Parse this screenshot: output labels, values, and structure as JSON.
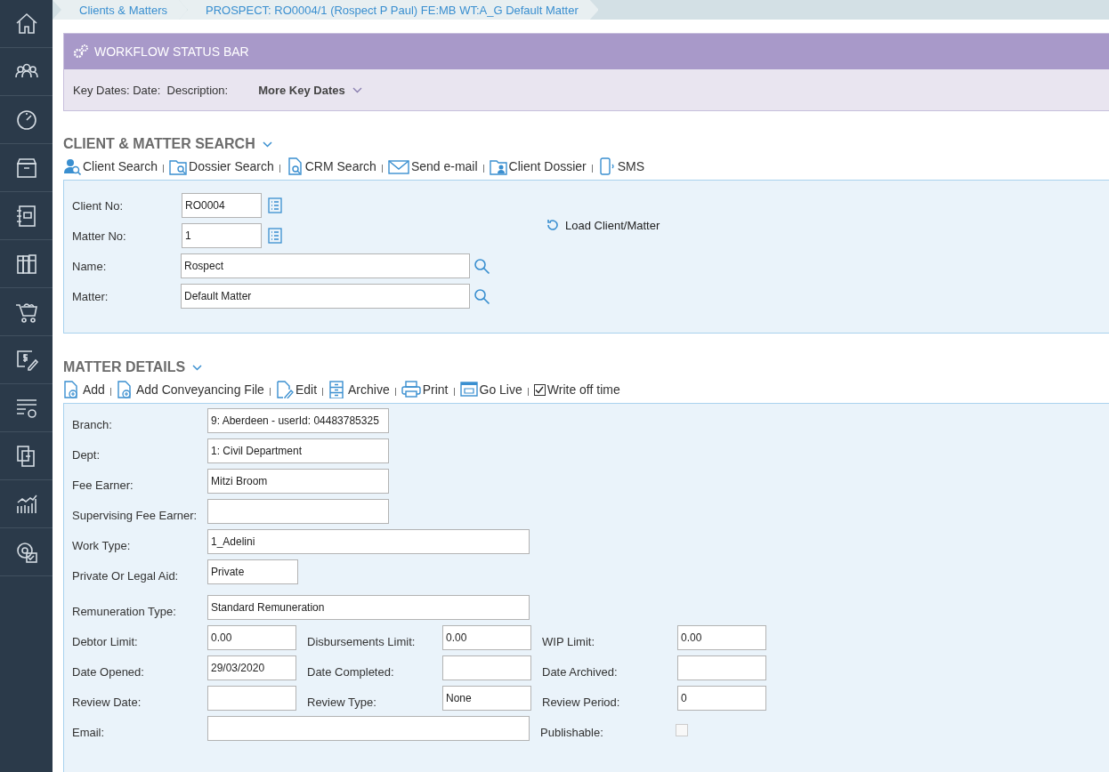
{
  "breadcrumbs": [
    {
      "label": "Clients & Matters"
    },
    {
      "label": "PROSPECT: RO0004/1 (Rospect P Paul) FE:MB WT:A_G Default Matter"
    }
  ],
  "workflow": {
    "title": "WORKFLOW STATUS BAR",
    "key_dates_label": "Key Dates: Date:",
    "description_label": "Description:",
    "more_button": "More Key Dates"
  },
  "client_search": {
    "title": "CLIENT & MATTER SEARCH",
    "toolbar": [
      {
        "label": "Client Search"
      },
      {
        "label": "Dossier Search"
      },
      {
        "label": "CRM Search"
      },
      {
        "label": "Send e-mail"
      },
      {
        "label": "Client Dossier"
      },
      {
        "label": "SMS"
      }
    ],
    "fields": [
      {
        "label": "Client No:",
        "value": "RO0004"
      },
      {
        "label": "Matter No:",
        "value": "1"
      },
      {
        "label": "Name:",
        "value": "Rospect"
      },
      {
        "label": "Matter:",
        "value": "Default Matter"
      }
    ],
    "load_button": "Load Client/Matter"
  },
  "matter_details": {
    "title": "MATTER DETAILS",
    "toolbar": [
      {
        "kind": "link",
        "label": "Add"
      },
      {
        "kind": "link",
        "label": "Add Conveyancing File"
      },
      {
        "kind": "link",
        "label": "Edit"
      },
      {
        "kind": "link",
        "label": "Archive"
      },
      {
        "kind": "link",
        "label": "Print"
      },
      {
        "kind": "link",
        "label": "Go Live"
      },
      {
        "kind": "checkbox",
        "label": "Write off time",
        "checked": true
      }
    ],
    "rows": [
      [
        {
          "kind": "text",
          "label": "Branch:",
          "value": "9: Aberdeen - userId: 04483785325"
        }
      ],
      [
        {
          "kind": "text",
          "label": "Dept:",
          "value": "1: Civil Department"
        }
      ],
      [
        {
          "kind": "text",
          "label": "Fee Earner:",
          "value": "Mitzi Broom"
        }
      ],
      [
        {
          "kind": "text",
          "label": "Supervising Fee Earner:"
        }
      ],
      [
        {
          "kind": "text",
          "label": "Work Type:",
          "value": "1_Adelini"
        }
      ],
      [
        {
          "kind": "text",
          "label": "Private Or Legal Aid:",
          "value": "Private"
        }
      ],
      [
        {
          "kind": "text",
          "label": "Remuneration Type:",
          "value": "Standard Remuneration"
        }
      ],
      [
        {
          "kind": "text",
          "label": "Debtor Limit:",
          "value": "0.00"
        },
        {
          "kind": "text",
          "label": "Disbursements Limit:",
          "value": "0.00"
        },
        {
          "kind": "text",
          "label": "WIP Limit:",
          "value": "0.00"
        }
      ],
      [
        {
          "kind": "text",
          "label": "Date Opened:",
          "value": "29/03/2020"
        },
        {
          "kind": "text",
          "label": "Date Completed:"
        },
        {
          "kind": "text",
          "label": "Date Archived:"
        }
      ],
      [
        {
          "kind": "text",
          "label": "Review Date:"
        },
        {
          "kind": "text",
          "label": "Review Type:",
          "value": "None"
        },
        {
          "kind": "text",
          "label": "Review Period:",
          "value": "0"
        }
      ],
      [
        {
          "kind": "text",
          "label": "Email:"
        },
        "",
        {
          "kind": "checkbox",
          "label": "Publishable:",
          "checked": false
        }
      ]
    ]
  }
}
